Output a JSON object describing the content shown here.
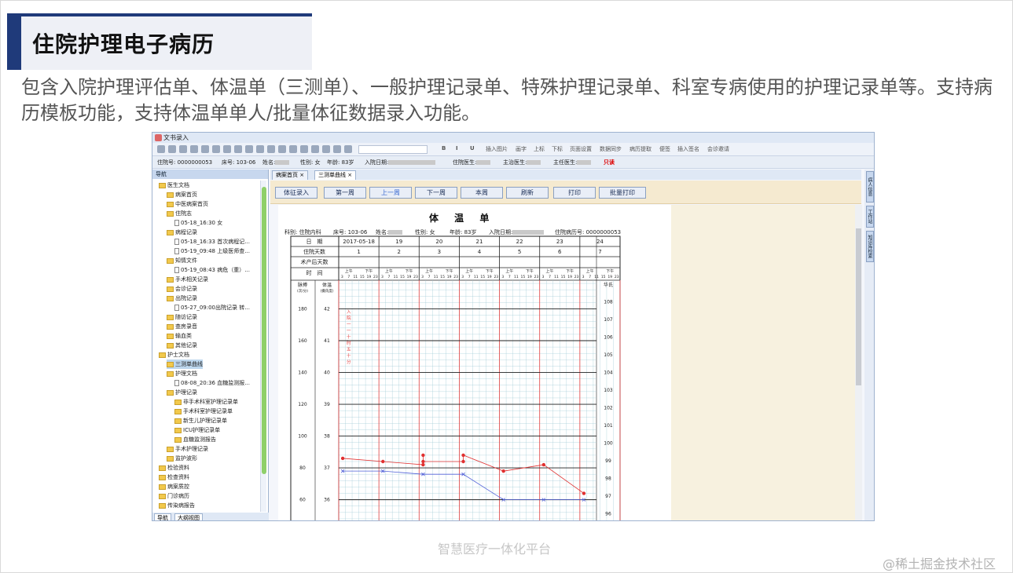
{
  "slide": {
    "title": "住院护理电子病历",
    "description": "包含入院护理评估单、体温单（三测单）、一般护理记录单、特殊护理记录单、科室专病使用的护理记录单等。支持病历模板功能，支持体温单单人/批量体征数据录入功能。",
    "watermark": "智慧医疗一体化平台",
    "credit": "@稀土掘金技术社区"
  },
  "app": {
    "window_title": "文书录入",
    "toolbar": [
      "插入图片",
      "画字",
      "上标",
      "下标",
      "页面设置",
      "数据同步",
      "病历提取",
      "便签",
      "插入签名",
      "会诊邀请"
    ],
    "info": {
      "admission_no": "住院号: 0000000053",
      "bed": "床号: 103-06",
      "name": "姓名:",
      "sex": "性别: 女",
      "age": "年龄: 83岁",
      "admit_date": "入院日期:",
      "resident": "住院医生:",
      "attending": "主治医生:",
      "chief": "主任医生:",
      "readonly": "只读"
    },
    "nav": {
      "header": "导航",
      "tabs": [
        "导航",
        "大纲视图"
      ],
      "tree": [
        {
          "label": "医生文档",
          "level": 0,
          "type": "folder"
        },
        {
          "label": "病案首页",
          "level": 1,
          "type": "folder"
        },
        {
          "label": "中医病案首页",
          "level": 1,
          "type": "folder"
        },
        {
          "label": "住院志",
          "level": 1,
          "type": "folder"
        },
        {
          "label": "05-18_16:30 女",
          "level": 2,
          "type": "doc"
        },
        {
          "label": "病程记录",
          "level": 1,
          "type": "folder"
        },
        {
          "label": "05-18_16:33 首次病程记...",
          "level": 2,
          "type": "doc"
        },
        {
          "label": "05-19_09:48 上级医师查...",
          "level": 2,
          "type": "doc"
        },
        {
          "label": "知情文件",
          "level": 1,
          "type": "folder"
        },
        {
          "label": "05-19_08:43 病危（重）...",
          "level": 2,
          "type": "doc"
        },
        {
          "label": "手术相关记录",
          "level": 1,
          "type": "folder"
        },
        {
          "label": "会诊记录",
          "level": 1,
          "type": "folder"
        },
        {
          "label": "出院记录",
          "level": 1,
          "type": "folder"
        },
        {
          "label": "05-27_09:00出院记录 转...",
          "level": 2,
          "type": "doc"
        },
        {
          "label": "随访记录",
          "level": 1,
          "type": "folder"
        },
        {
          "label": "查房录音",
          "level": 1,
          "type": "folder"
        },
        {
          "label": "输血类",
          "level": 1,
          "type": "folder"
        },
        {
          "label": "其他记录",
          "level": 1,
          "type": "folder"
        },
        {
          "label": "护士文档",
          "level": 0,
          "type": "folder"
        },
        {
          "label": "三测单曲线",
          "level": 1,
          "type": "folder",
          "selected": true
        },
        {
          "label": "护理文档",
          "level": 1,
          "type": "folder"
        },
        {
          "label": "08-08_20:36 血糖监测报...",
          "level": 2,
          "type": "doc"
        },
        {
          "label": "护理记录",
          "level": 1,
          "type": "folder"
        },
        {
          "label": "非手术科室护理记录单",
          "level": 2,
          "type": "folder"
        },
        {
          "label": "手术科室护理记录单",
          "level": 2,
          "type": "folder"
        },
        {
          "label": "新生儿护理记录单",
          "level": 2,
          "type": "folder"
        },
        {
          "label": "ICU护理记录单",
          "level": 2,
          "type": "folder"
        },
        {
          "label": "血糖监测报告",
          "level": 2,
          "type": "folder"
        },
        {
          "label": "手术护理记录",
          "level": 1,
          "type": "folder"
        },
        {
          "label": "监护波形",
          "level": 1,
          "type": "folder"
        },
        {
          "label": "检验资料",
          "level": 0,
          "type": "folder"
        },
        {
          "label": "检查资料",
          "level": 0,
          "type": "folder"
        },
        {
          "label": "病案质控",
          "level": 0,
          "type": "folder"
        },
        {
          "label": "门诊病历",
          "level": 0,
          "type": "folder"
        },
        {
          "label": "传染病报告",
          "level": 0,
          "type": "folder"
        }
      ]
    },
    "doc_tabs": [
      "病案首页",
      "三测单曲线"
    ],
    "buttons": [
      "体征录入",
      "第一周",
      "上一周",
      "下一周",
      "本周",
      "刷新",
      "打印",
      "批量打印"
    ],
    "side_tabs": [
      "病人信息",
      "工作站",
      "知识库检索"
    ]
  },
  "chart_data": {
    "type": "line",
    "title": "体 温 单",
    "header": {
      "dept": "科别: 住院内科",
      "bed": "床号: 103-06",
      "name": "姓名:",
      "sex": "性别: 女",
      "age": "年龄: 83岁",
      "admit": "入院日期:",
      "case_no": "住院病历号: 0000000053"
    },
    "row_labels": [
      "日　期",
      "住院天数",
      "术产后天数",
      "时　间"
    ],
    "dates": [
      "2017-05-18",
      "19",
      "20",
      "21",
      "22",
      "23",
      "24"
    ],
    "hospital_days": [
      "1",
      "2",
      "3",
      "4",
      "5",
      "6",
      "7"
    ],
    "period_labels": [
      "上午",
      "下午"
    ],
    "hour_ticks": [
      "3",
      "7",
      "11",
      "15",
      "19",
      "23"
    ],
    "pulse_label": "脉搏\n(次/分)",
    "temp_label": "体温\n(摄氏度)",
    "fahrenheit_label": "华氏",
    "pulse_ticks": [
      "180",
      "160",
      "140",
      "120",
      "100",
      "80",
      "60"
    ],
    "temp_ticks": [
      "42",
      "41",
      "40",
      "39",
      "38",
      "37",
      "36"
    ],
    "fahrenheit_ticks": [
      "108",
      "107",
      "106",
      "105",
      "104",
      "103",
      "102",
      "101",
      "100",
      "99",
      "98",
      "97",
      "96"
    ],
    "annotation": "入院一一十时五十分",
    "ylim_temp": [
      35.3,
      42.9
    ],
    "series": [
      {
        "color": "#e03030",
        "x": [
          0.1,
          1.1,
          2.1,
          2.1,
          2.1,
          3.1,
          3.1,
          4.1,
          5.1,
          6.1
        ],
        "y": [
          37.3,
          37.2,
          37.1,
          37.4,
          37.2,
          37.2,
          37.4,
          36.9,
          37.1,
          36.2
        ]
      },
      {
        "color": "#5060d8",
        "x": [
          0.1,
          1.1,
          2.1,
          3.1,
          4.1,
          5.1,
          6.1
        ],
        "y": [
          36.9,
          36.9,
          36.8,
          36.8,
          36.0,
          36.0,
          36.0
        ]
      }
    ]
  }
}
